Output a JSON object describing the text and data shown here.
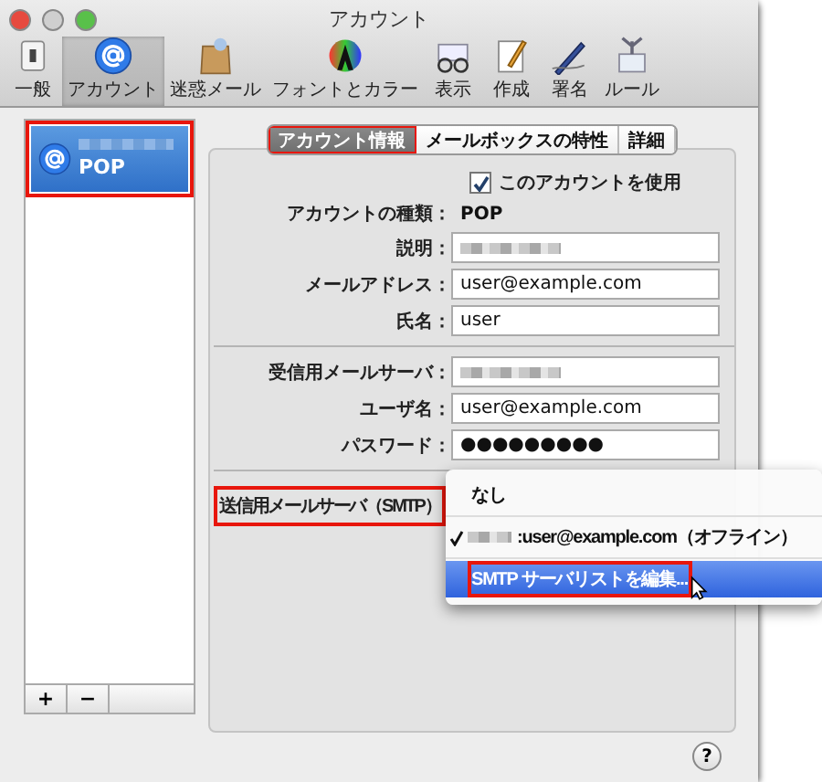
{
  "window": {
    "title": "アカウント"
  },
  "toolbar": [
    {
      "label": "一般",
      "selected": false
    },
    {
      "label": "アカウント",
      "selected": true
    },
    {
      "label": "迷惑メール",
      "selected": false
    },
    {
      "label": "フォントとカラー",
      "selected": false
    },
    {
      "label": "表示",
      "selected": false
    },
    {
      "label": "作成",
      "selected": false
    },
    {
      "label": "署名",
      "selected": false
    },
    {
      "label": "ルール",
      "selected": false
    }
  ],
  "sidebar": {
    "highlighted": true,
    "accounts": [
      {
        "type": "POP",
        "selected": true
      }
    ],
    "buttons": [
      "+",
      "−"
    ]
  },
  "tabs": [
    {
      "label": "アカウント情報",
      "selected": true,
      "highlighted": true
    },
    {
      "label": "メールボックスの特性",
      "selected": false,
      "highlighted": false
    },
    {
      "label": "詳細",
      "selected": false,
      "highlighted": false
    }
  ],
  "enable_checkbox": {
    "label": "このアカウントを使用",
    "checked": true
  },
  "sections": [
    [
      {
        "kind": "static",
        "label": "アカウントの種類：",
        "value": "POP"
      },
      {
        "kind": "blurred",
        "label": "説明："
      },
      {
        "kind": "text",
        "label": "メールアドレス：",
        "value": "user@example.com"
      },
      {
        "kind": "text",
        "label": "氏名：",
        "value": "user"
      }
    ],
    [
      {
        "kind": "blurred",
        "label": "受信用メールサーバ："
      },
      {
        "kind": "text",
        "label": "ユーザ名：",
        "value": "user@example.com"
      },
      {
        "kind": "text",
        "label": "パスワード：",
        "value": "●●●●●●●●●"
      }
    ]
  ],
  "smtp": {
    "label": "送信用メールサーバ（SMTP）",
    "highlighted": true
  },
  "smtp_menu": [
    {
      "kind": "plain",
      "label": "なし",
      "checked": false,
      "selected": false,
      "highlighted": false
    },
    {
      "kind": "blurred",
      "label": ":user@example.com（オフライン）",
      "checked": true,
      "selected": false,
      "highlighted": false
    },
    {
      "kind": "plain",
      "label": "SMTP サーバリストを編集...",
      "checked": false,
      "selected": true,
      "highlighted": true
    }
  ],
  "help": "?"
}
